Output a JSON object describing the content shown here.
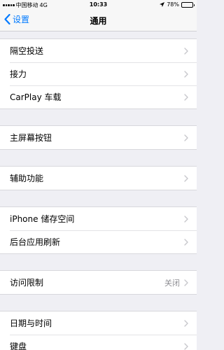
{
  "status_bar": {
    "carrier": "中国移动",
    "network": "4G",
    "time": "10:33",
    "battery_percent": "78%",
    "battery_level": 0.78
  },
  "nav": {
    "back_label": "设置",
    "title": "通用"
  },
  "groups": [
    {
      "items": [
        {
          "label": "隔空投送"
        },
        {
          "label": "接力"
        },
        {
          "label": "CarPlay 车载"
        }
      ]
    },
    {
      "items": [
        {
          "label": "主屏幕按钮"
        }
      ]
    },
    {
      "items": [
        {
          "label": "辅助功能"
        }
      ]
    },
    {
      "items": [
        {
          "label": "iPhone 储存空间"
        },
        {
          "label": "后台应用刷新"
        }
      ]
    },
    {
      "items": [
        {
          "label": "访问限制",
          "value": "关闭"
        }
      ]
    },
    {
      "items": [
        {
          "label": "日期与时间"
        },
        {
          "label": "键盘"
        }
      ]
    }
  ],
  "colors": {
    "accent": "#007aff",
    "background": "#efeff4",
    "chevron": "#c7c7cc"
  }
}
